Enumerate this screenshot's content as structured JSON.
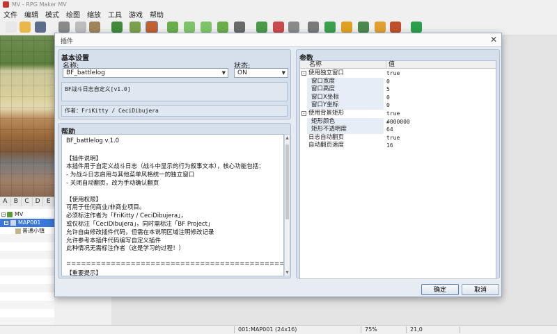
{
  "app": {
    "title": "MV - RPG Maker MV"
  },
  "menu": [
    "文件",
    "编辑",
    "模式",
    "绘图",
    "缩放",
    "工具",
    "游戏",
    "帮助"
  ],
  "toolbar_icons": [
    {
      "name": "new-project-icon",
      "color": "#e8e8e8"
    },
    {
      "name": "open-project-icon",
      "color": "#e9b84a"
    },
    {
      "name": "save-project-icon",
      "color": "#5b6c8a"
    },
    {
      "name": "cut-icon",
      "color": "#8a8a8a"
    },
    {
      "name": "copy-icon",
      "color": "#bdbdbd"
    },
    {
      "name": "paste-icon",
      "color": "#a0855b"
    },
    {
      "name": "undo-icon",
      "color": "#3f8b3a"
    },
    {
      "name": "map-mode-icon",
      "color": "#7aa04a"
    },
    {
      "name": "event-mode-icon",
      "color": "#c0612f"
    },
    {
      "name": "pencil-icon",
      "color": "#6aae4a"
    },
    {
      "name": "rectangle-icon",
      "color": "#7ec46a"
    },
    {
      "name": "ellipse-icon",
      "color": "#7ec46a"
    },
    {
      "name": "flood-fill-icon",
      "color": "#6aae4a"
    },
    {
      "name": "shadow-pen-icon",
      "color": "#6a6a6a"
    },
    {
      "name": "zoom-in-icon",
      "color": "#4a9a4a"
    },
    {
      "name": "zoom-out-icon",
      "color": "#c84a4a"
    },
    {
      "name": "zoom-actual-icon",
      "color": "#8a8a8a"
    },
    {
      "name": "database-icon",
      "color": "#7a7a7a"
    },
    {
      "name": "plugin-manager-icon",
      "color": "#3aa04a"
    },
    {
      "name": "sound-test-icon",
      "color": "#e0a020"
    },
    {
      "name": "event-searcher-icon",
      "color": "#4a8a4a"
    },
    {
      "name": "resource-manager-icon",
      "color": "#e0a030"
    },
    {
      "name": "character-generator-icon",
      "color": "#c0502a"
    },
    {
      "name": "playtest-icon",
      "color": "#2aa04a"
    }
  ],
  "tileset_tabs": [
    "A",
    "B",
    "C",
    "D",
    "E"
  ],
  "map_tree": [
    {
      "label": "MV",
      "selected": false
    },
    {
      "label": "MAP001",
      "selected": true
    },
    {
      "label": "普通小镇",
      "selected": false
    }
  ],
  "statusbar": {
    "map": "001:MAP001 (24x16)",
    "zoom": "75%",
    "coords": "21,0"
  },
  "dialog": {
    "title": "插件",
    "close_glyph": "✕",
    "basic": {
      "heading": "基本设置",
      "name_label": "名称:",
      "name_value": "BF_battlelog",
      "status_label": "状态:",
      "status_value": "ON",
      "description": "BF战斗日志自定义[v1.0]",
      "author": "作者：FriKitty / CeciDibujera"
    },
    "help": {
      "heading": "帮助",
      "lines": [
        "BF_battlelog v.1.0",
        "",
        "【插件说明】",
        "本插件用于自定义战斗日志（战斗中显示的行为叙事文本），核心功能包括：",
        "- 为战斗日志启用与其他菜单风格统一的独立窗口",
        "- 关闭自动翻页，改为手动确认翻页",
        "",
        "【使用权限】",
        "可用于任何商业/非商业项目。",
        "必须标注作者为「FriKitty / CeciDibujera」，",
        "或仅标注「CeciDibujera」，同时需标注「BF Project」",
        "允许自由修改插件代码，但需在本说明区域注明修改记录",
        "允许参考本插件代码编写自定义插件",
        "此种情况无需标注作者（这是学习的过程！）",
        "",
        "=====================================================",
        "【重要提示】"
      ]
    },
    "params": {
      "heading": "参数",
      "col_name": "名称",
      "col_value": "值",
      "rows": [
        {
          "name": "使用独立窗口",
          "value": "true",
          "level": 0,
          "expander": "-"
        },
        {
          "name": "窗口宽度",
          "value": "0",
          "level": 1
        },
        {
          "name": "窗口高度",
          "value": "5",
          "level": 1
        },
        {
          "name": "窗口X坐标",
          "value": "0",
          "level": 1
        },
        {
          "name": "窗口Y坐标",
          "value": "0",
          "level": 1
        },
        {
          "name": "使用背景矩形",
          "value": "true",
          "level": 0,
          "expander": "-"
        },
        {
          "name": "矩形颜色",
          "value": "#000000",
          "level": 1
        },
        {
          "name": "矩形不透明度",
          "value": "64",
          "level": 1
        },
        {
          "name": "日志自动翻页",
          "value": "true",
          "level": 0
        },
        {
          "name": "自动翻页速度",
          "value": "16",
          "level": 0
        }
      ]
    },
    "buttons": {
      "ok": "确定",
      "cancel": "取消"
    }
  }
}
